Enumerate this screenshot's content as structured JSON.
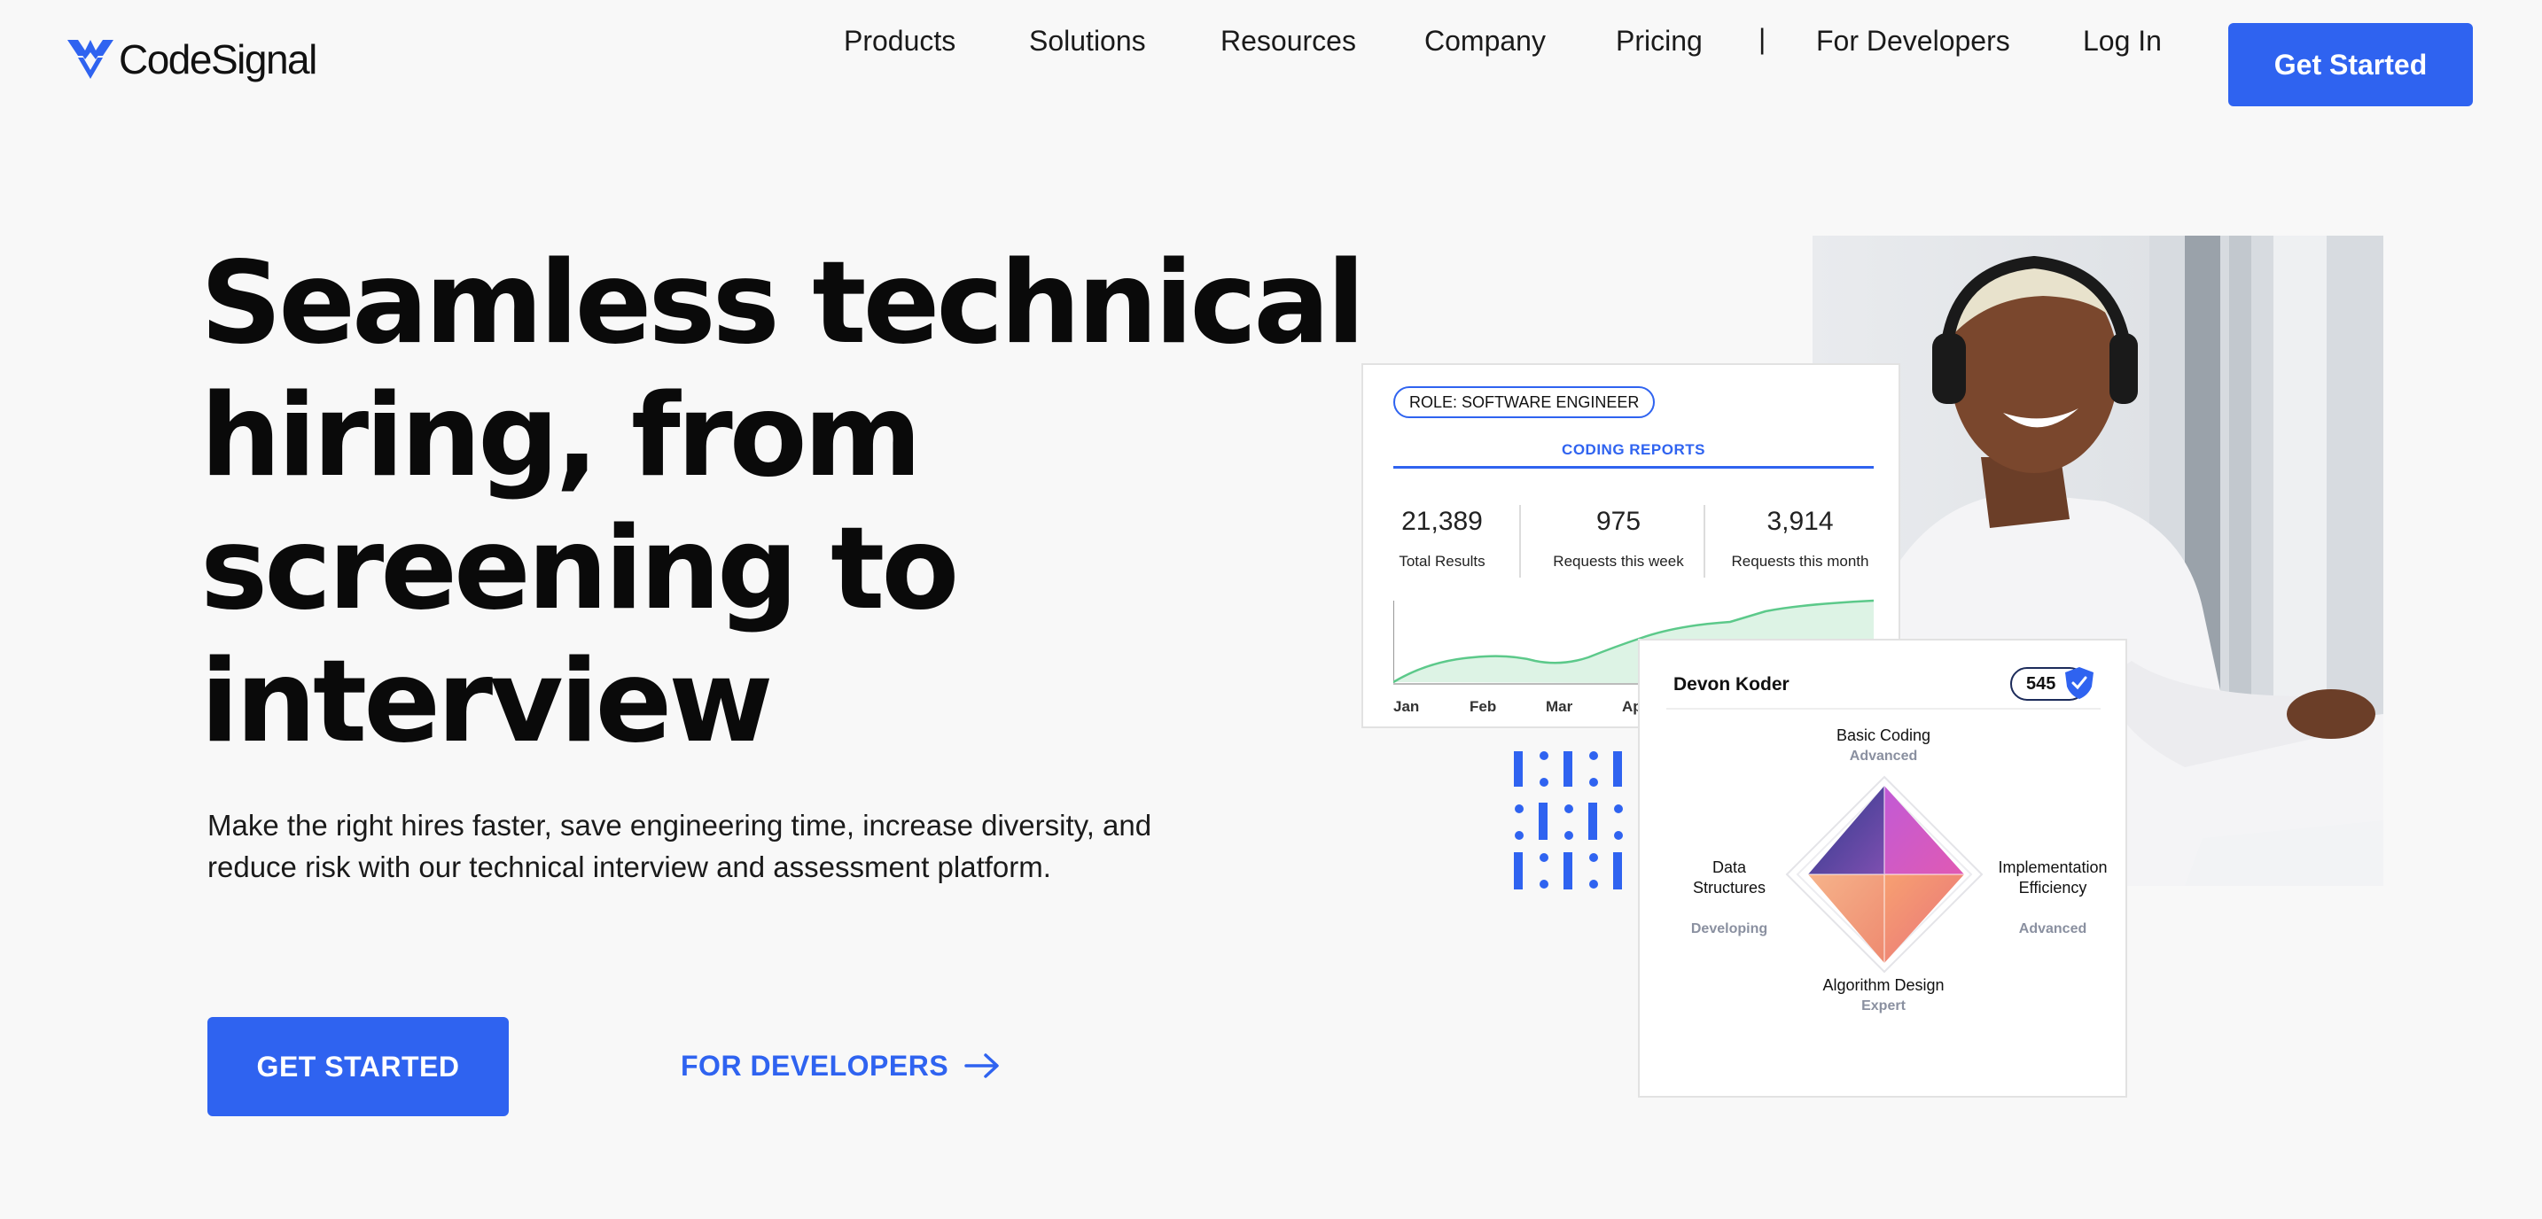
{
  "brand": {
    "name": "CodeSignal",
    "accent": "#2f63f0"
  },
  "nav": {
    "links": [
      "Products",
      "Solutions",
      "Resources",
      "Company",
      "Pricing"
    ],
    "separator": "|",
    "for_developers": "For Developers",
    "login": "Log In",
    "cta": "Get Started"
  },
  "hero": {
    "headline": [
      "Seamless technical",
      "hiring, from",
      "screening to",
      "interview"
    ],
    "subtext": "Make the right hires faster, save engineering time, increase diversity, and reduce risk with our technical interview and assessment platform.",
    "primary_cta": "GET STARTED",
    "secondary_cta": "FOR DEVELOPERS"
  },
  "report_card": {
    "role": "ROLE: SOFTWARE ENGINEER",
    "title": "CODING REPORTS",
    "stats": [
      {
        "value": "21,389",
        "label": "Total Results"
      },
      {
        "value": "975",
        "label": "Requests this week"
      },
      {
        "value": "3,914",
        "label": "Requests this month"
      }
    ],
    "months": [
      "Jan",
      "Feb",
      "Mar",
      "Ap"
    ],
    "line_color": "#5cc98a"
  },
  "profile_card": {
    "name": "Devon Koder",
    "score": "545",
    "skills": {
      "top": {
        "name": "Basic Coding",
        "level": "Advanced"
      },
      "left": {
        "name": "Data\nStructures",
        "level": "Developing"
      },
      "right": {
        "name": "Implementation\nEfficiency",
        "level": "Advanced"
      },
      "bottom": {
        "name": "Algorithm Design",
        "level": "Expert"
      }
    }
  }
}
